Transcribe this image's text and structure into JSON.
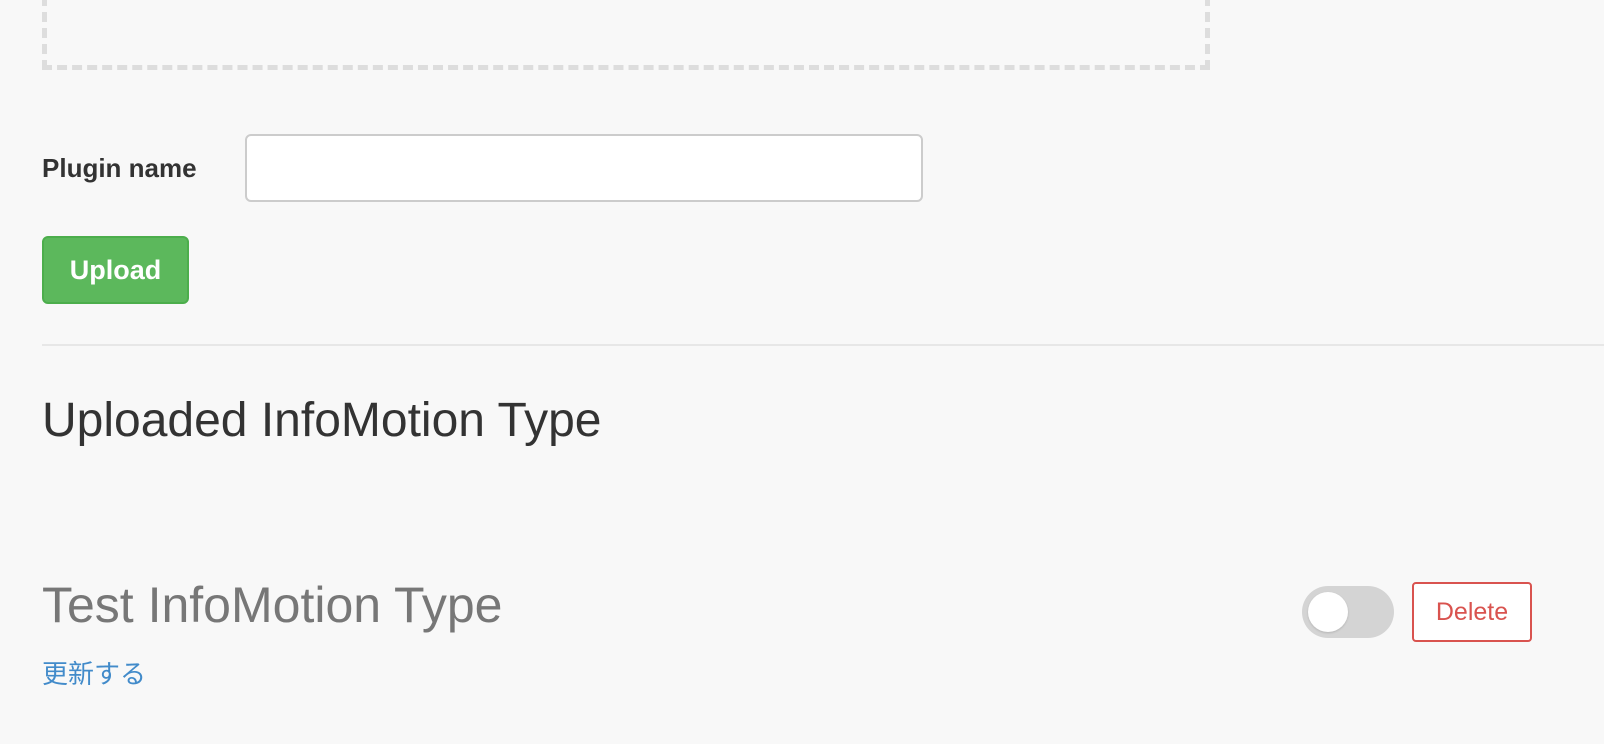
{
  "upload_form": {
    "plugin_name_label": "Plugin name",
    "plugin_name_value": "",
    "plugin_name_placeholder": "",
    "upload_button_label": "Upload"
  },
  "uploaded_section": {
    "title": "Uploaded InfoMotion Type",
    "items": [
      {
        "name": "Test InfoMotion Type",
        "update_link_label": "更新する",
        "enabled": false,
        "delete_button_label": "Delete"
      }
    ]
  },
  "colors": {
    "upload_button": "#5cb85c",
    "delete_button": "#d9534f",
    "link": "#428bca",
    "toggle_off": "#d4d4d4"
  }
}
